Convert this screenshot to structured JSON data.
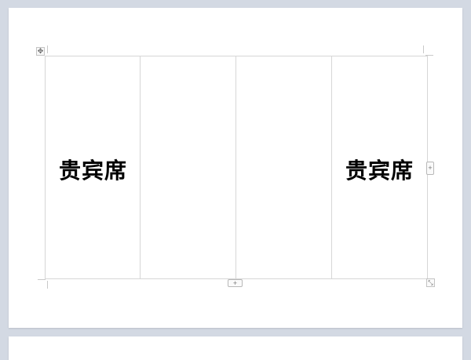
{
  "document": {
    "table": {
      "cells": [
        {
          "text": "贵宾席"
        },
        {
          "text": ""
        },
        {
          "text": ""
        },
        {
          "text": "贵宾席"
        }
      ]
    },
    "controls": {
      "move_icon": "move-icon",
      "add_column_icon": "plus-icon",
      "add_row_icon": "plus-icon",
      "resize_icon": "resize-icon"
    }
  }
}
